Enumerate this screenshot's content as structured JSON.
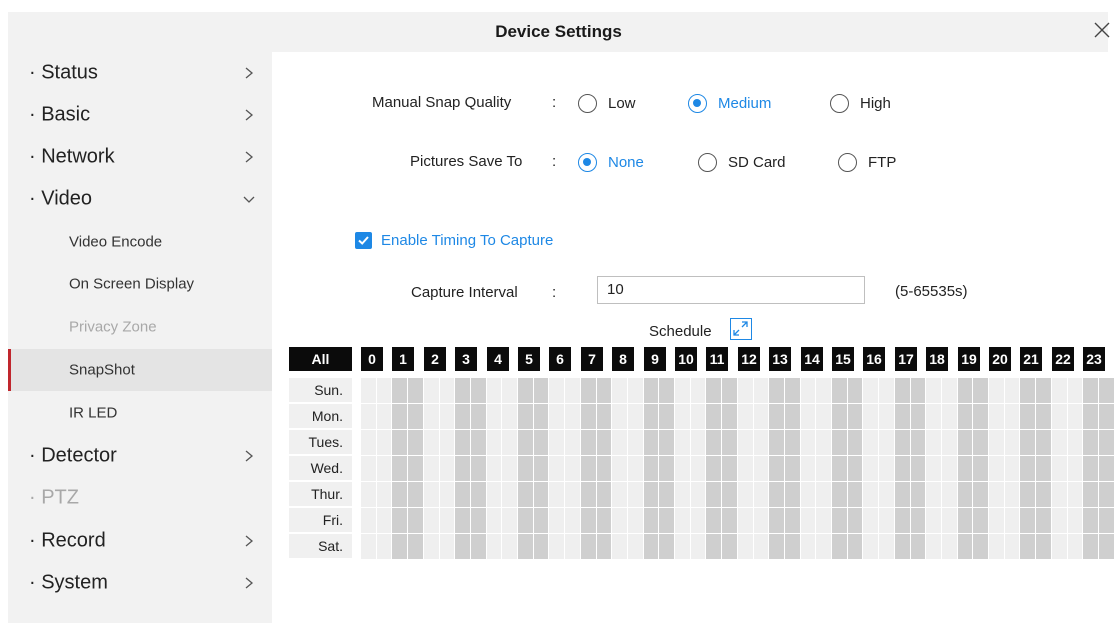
{
  "window": {
    "title": "Device Settings"
  },
  "sidebar": {
    "items": [
      {
        "label": "· Status",
        "level": "top",
        "chevron": "right"
      },
      {
        "label": "· Basic",
        "level": "top",
        "chevron": "right"
      },
      {
        "label": "· Network",
        "level": "top",
        "chevron": "right"
      },
      {
        "label": "· Video",
        "level": "top",
        "chevron": "down"
      },
      {
        "label": "Video Encode",
        "level": "sub"
      },
      {
        "label": "On Screen Display",
        "level": "sub"
      },
      {
        "label": "Privacy Zone",
        "level": "sub",
        "disabled": true
      },
      {
        "label": "SnapShot",
        "level": "sub",
        "active": true
      },
      {
        "label": "IR LED",
        "level": "sub"
      },
      {
        "label": "· Detector",
        "level": "top",
        "chevron": "right"
      },
      {
        "label": "· PTZ",
        "level": "top",
        "disabled": true
      },
      {
        "label": "· Record",
        "level": "top",
        "chevron": "right"
      },
      {
        "label": "· System",
        "level": "top",
        "chevron": "right"
      }
    ]
  },
  "form": {
    "snap_quality": {
      "label": "Manual Snap Quality",
      "colon": ":",
      "options": [
        "Low",
        "Medium",
        "High"
      ],
      "selected": "Medium"
    },
    "save_to": {
      "label": "Pictures Save To",
      "colon": ":",
      "options": [
        "None",
        "SD Card",
        "FTP"
      ],
      "selected": "None"
    },
    "enable_timing": {
      "label": "Enable Timing To Capture",
      "checked": true
    },
    "capture_interval": {
      "label": "Capture Interval",
      "colon": ":",
      "value": "10",
      "range": "(5-65535s)"
    }
  },
  "schedule": {
    "title": "Schedule",
    "all_label": "All",
    "hours": [
      "0",
      "1",
      "2",
      "3",
      "4",
      "5",
      "6",
      "7",
      "8",
      "9",
      "10",
      "11",
      "12",
      "13",
      "14",
      "15",
      "16",
      "17",
      "18",
      "19",
      "20",
      "21",
      "22",
      "23"
    ],
    "days": [
      "Sun.",
      "Mon.",
      "Tues.",
      "Wed.",
      "Thur.",
      "Fri.",
      "Sat."
    ]
  },
  "colors": {
    "accent": "#1e88e5",
    "active_marker": "#c0262d",
    "cell_light": "#efefef",
    "cell_dark": "#cfcfcf"
  },
  "icons": {
    "close": "close-icon",
    "chevron_right": "chevron-right-icon",
    "chevron_down": "chevron-down-icon",
    "expand": "expand-icon",
    "check": "check-icon"
  }
}
